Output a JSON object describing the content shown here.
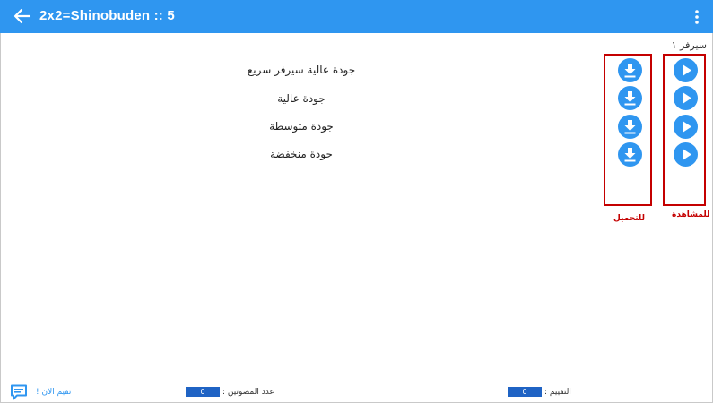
{
  "appbar": {
    "title": "2x2=Shinobuden :: 5",
    "back_icon": "arrow-left-icon",
    "menu_icon": "more-vertical-icon"
  },
  "server": {
    "label": "سيرفر ١"
  },
  "qualities": [
    {
      "label": "جودة عالية سيرفر سريع"
    },
    {
      "label": "جودة عالية"
    },
    {
      "label": "جودة متوسطة"
    },
    {
      "label": "جودة منخفضة"
    }
  ],
  "captions": {
    "download": "للتحميل",
    "watch": "للمشاهدة"
  },
  "footer": {
    "rating_label": "التقييم :",
    "rating_value": "0",
    "votes_label": "عدد المصوتين :",
    "votes_value": "0",
    "rate_now": "تقيم الان !",
    "chat_icon": "comment-icon"
  },
  "colors": {
    "primary": "#2f96f0",
    "annotation_red": "#c40000",
    "field_blue": "#1f63c4"
  }
}
